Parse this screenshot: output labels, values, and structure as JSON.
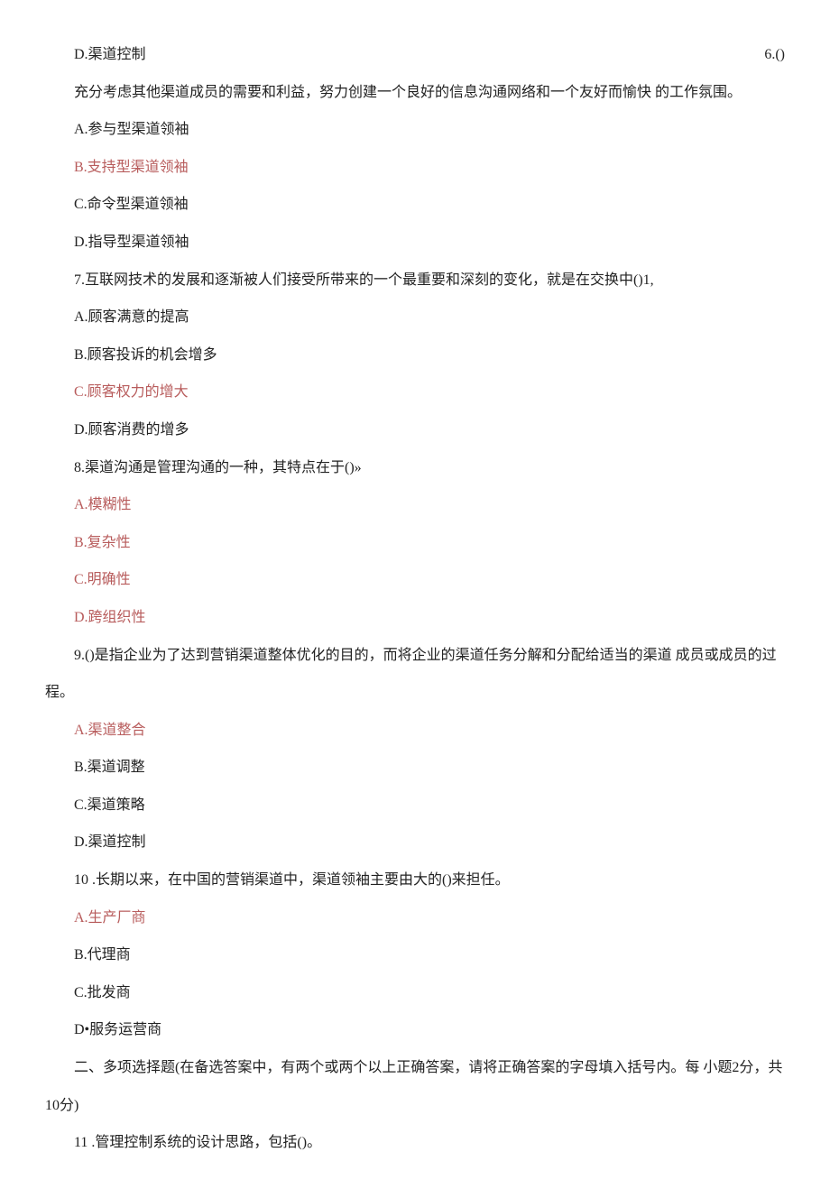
{
  "first_row_left": "D.渠道控制",
  "first_row_right": "6.()",
  "q6_stem_cont": "充分考虑其他渠道成员的需要和利益，努力创建一个良好的信息沟通网络和一个友好而愉快 的工作氛围。",
  "q6_a": "A.参与型渠道领袖",
  "q6_b": "B.支持型渠道领袖",
  "q6_c": "C.命令型渠道领袖",
  "q6_d": "D.指导型渠道领袖",
  "q7_stem": "7.互联网技术的发展和逐渐被人们接受所带来的一个最重要和深刻的变化，就是在交换中()1,",
  "q7_a": "A.顾客满意的提高",
  "q7_b": "B.顾客投诉的机会增多",
  "q7_c": "C.顾客权力的增大",
  "q7_d": "D.顾客消费的增多",
  "q8_stem": "8.渠道沟通是管理沟通的一种，其特点在于()»",
  "q8_a": "A.模糊性",
  "q8_b": "B.复杂性",
  "q8_c": "C.明确性",
  "q8_d": "D.跨组织性",
  "q9_stem": "9.()是指企业为了达到营销渠道整体优化的目的，而将企业的渠道任务分解和分配给适当的渠道 成员或成员的过程。",
  "q9_a": "A.渠道整合",
  "q9_b": "B.渠道调整",
  "q9_c": "C.渠道策略",
  "q9_d": "D.渠道控制",
  "q10_stem": "10 .长期以来，在中国的营销渠道中，渠道领袖主要由大的()来担任。",
  "q10_a": "A.生产厂商",
  "q10_b": "B.代理商",
  "q10_c": "C.批发商",
  "q10_d": "D•服务运营商",
  "section2": "二、多项选择题(在备选答案中，有两个或两个以上正确答案，请将正确答案的字母填入括号内。每 小题2分，共10分)",
  "q11_stem": "11 .管理控制系统的设计思路，包括()。"
}
